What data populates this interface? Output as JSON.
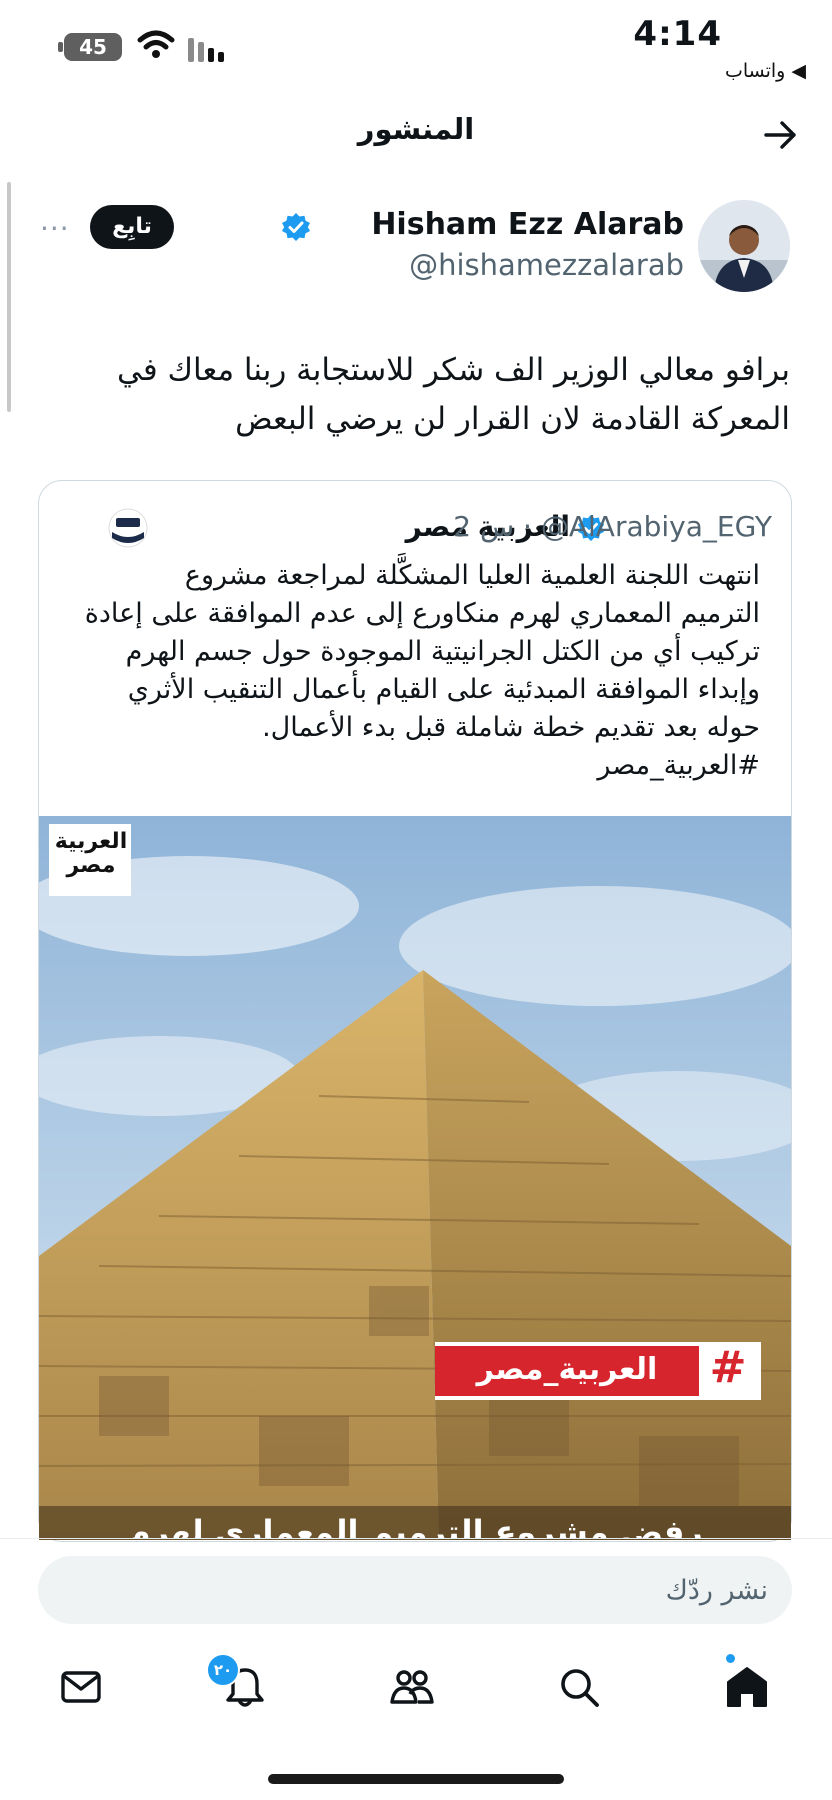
{
  "status_bar": {
    "time": "4:14",
    "back_app": "◀ واتساب",
    "battery": "45"
  },
  "header": {
    "title": "المنشور"
  },
  "post": {
    "author_name": "Hisham Ezz Alarab",
    "author_handle": "@hishamezzalarab",
    "follow_label": "تابِع",
    "more_label": "···",
    "text_lines": [
      "برافو معالي الوزير الف شكر للاستجابة  ربنا معاك في",
      "المعركة القادمة لان القرار لن يرضي البعض"
    ]
  },
  "quote": {
    "name": "العربية مصر",
    "handle_time": "2 س · @AlArabiya_EGY",
    "text_lines": [
      "انتهت اللجنة العلمية العليا المشكَّلة لمراجعة مشروع",
      "الترميم المعماري لهرم منكاورع إلى عدم الموافقة على إعادة",
      "تركيب أي من الكتل الجرانيتية الموجودة حول جسم الهرم",
      "وإبداء الموافقة المبدئية على القيام بأعمال التنقيب الأثري",
      "حوله بعد تقديم خطة شاملة قبل بدء الأعمال.",
      "#العربية_مصر"
    ],
    "image": {
      "logo_line1": "العربية",
      "logo_line2": "مصر",
      "hashtag_symbol": "#",
      "hashtag_text": "العربية_مصر",
      "caption_partial": "رفض مشروع الترميم المعماري لهرم"
    }
  },
  "reply": {
    "placeholder": "نشر ردّك"
  },
  "nav": {
    "notifications_badge": "٢٠",
    "icons": [
      "home-icon",
      "search-icon",
      "communities-icon",
      "notifications-icon",
      "messages-icon"
    ]
  },
  "colors": {
    "accent": "#1d9bf0",
    "text": "#0f1419",
    "secondary_text": "#536471",
    "hashtag_red": "#d6252c"
  }
}
